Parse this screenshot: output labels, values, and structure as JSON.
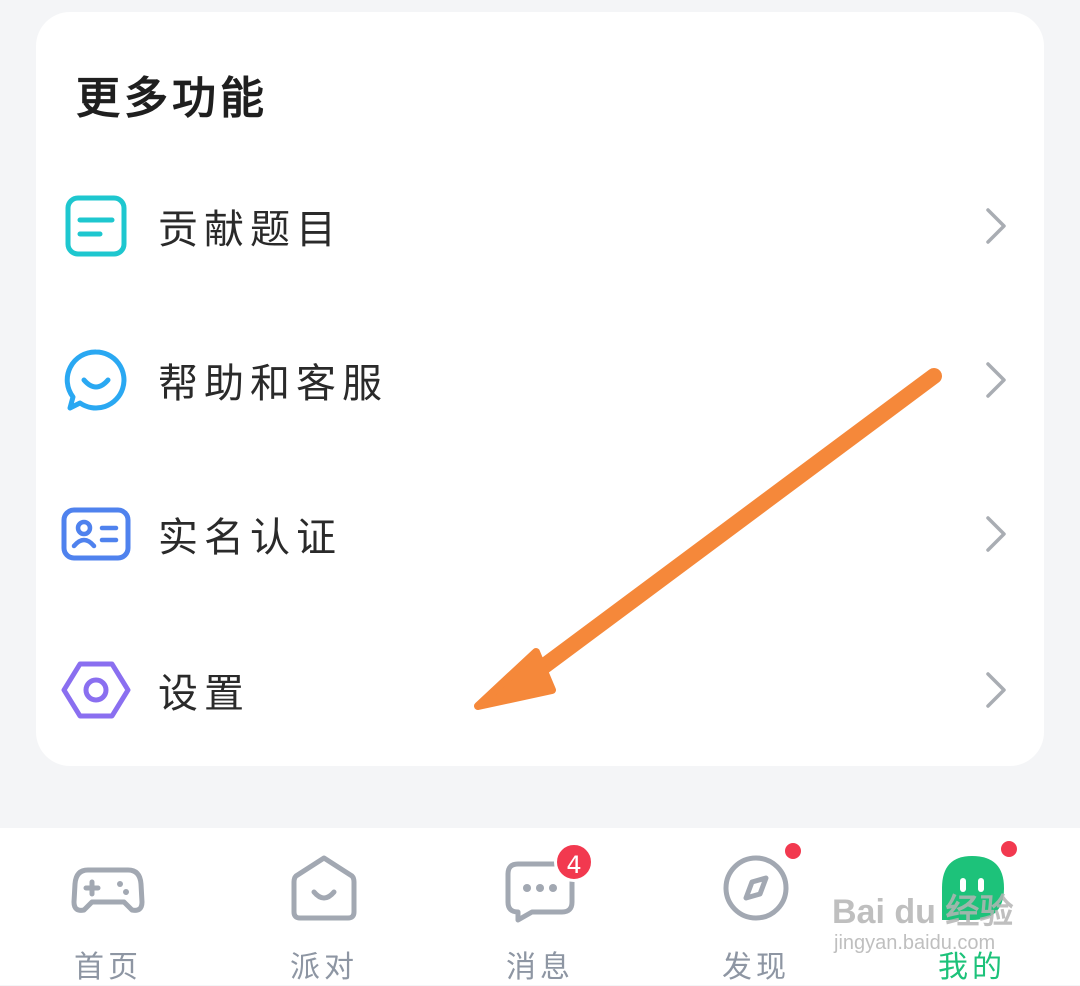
{
  "section": {
    "title": "更多功能",
    "items": [
      {
        "label": "贡献题目",
        "icon": "document-icon",
        "color": "#1ec7cf"
      },
      {
        "label": "帮助和客服",
        "icon": "chat-bubble-icon",
        "color": "#2aa8f2"
      },
      {
        "label": "实名认证",
        "icon": "id-card-icon",
        "color": "#4f82ee"
      },
      {
        "label": "设置",
        "icon": "hexagon-settings-icon",
        "color": "#8a6ff0"
      }
    ]
  },
  "tabbar": {
    "tabs": [
      {
        "label": "首页",
        "icon": "gamepad-icon",
        "active": false
      },
      {
        "label": "派对",
        "icon": "party-home-icon",
        "active": false
      },
      {
        "label": "消息",
        "icon": "message-icon",
        "active": false,
        "badge": "4"
      },
      {
        "label": "发现",
        "icon": "compass-icon",
        "active": false,
        "dot": true
      },
      {
        "label": "我的",
        "icon": "avatar-icon",
        "active": true,
        "dot": true
      }
    ]
  },
  "watermark": {
    "brand": "Bai du 经验",
    "sub": "jingyan.baidu.com"
  },
  "colors": {
    "accent_green": "#1dc27a",
    "badge_red": "#f2394f",
    "annotation_arrow": "#f5883a"
  }
}
